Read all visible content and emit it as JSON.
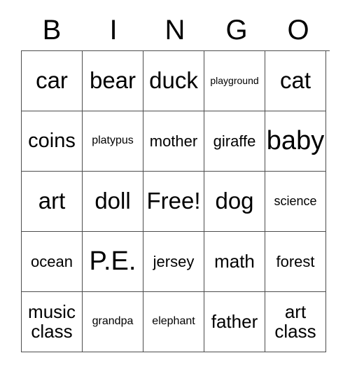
{
  "card": {
    "title_letters": [
      "B",
      "I",
      "N",
      "G",
      "O"
    ],
    "free_space_label": "Free!",
    "border_color": "#4d4d4d",
    "text_color": "#000000",
    "background_color": "#ffffff",
    "rows": [
      [
        {
          "text": "car",
          "size": "xl"
        },
        {
          "text": "bear",
          "size": "xl"
        },
        {
          "text": "duck",
          "size": "xl"
        },
        {
          "text": "playground",
          "size": "xs"
        },
        {
          "text": "cat",
          "size": "xl"
        }
      ],
      [
        {
          "text": "coins",
          "size": "l"
        },
        {
          "text": "platypus",
          "size": "s"
        },
        {
          "text": "mother",
          "size": "m"
        },
        {
          "text": "giraffe",
          "size": "m"
        },
        {
          "text": "baby",
          "size": "xxl"
        }
      ],
      [
        {
          "text": "art",
          "size": "xl"
        },
        {
          "text": "doll",
          "size": "xl"
        },
        {
          "text": "Free!",
          "size": "xl"
        },
        {
          "text": "dog",
          "size": "xl"
        },
        {
          "text": "science",
          "size": "sm"
        }
      ],
      [
        {
          "text": "ocean",
          "size": "m"
        },
        {
          "text": "P.E.",
          "size": "xxl"
        },
        {
          "text": "jersey",
          "size": "m"
        },
        {
          "text": "math",
          "size": "ml"
        },
        {
          "text": "forest",
          "size": "m"
        }
      ],
      [
        {
          "text": "music\nclass",
          "size": "ml"
        },
        {
          "text": "grandpa",
          "size": "s"
        },
        {
          "text": "elephant",
          "size": "s"
        },
        {
          "text": "father",
          "size": "ml"
        },
        {
          "text": "art\nclass",
          "size": "ml"
        }
      ]
    ]
  }
}
